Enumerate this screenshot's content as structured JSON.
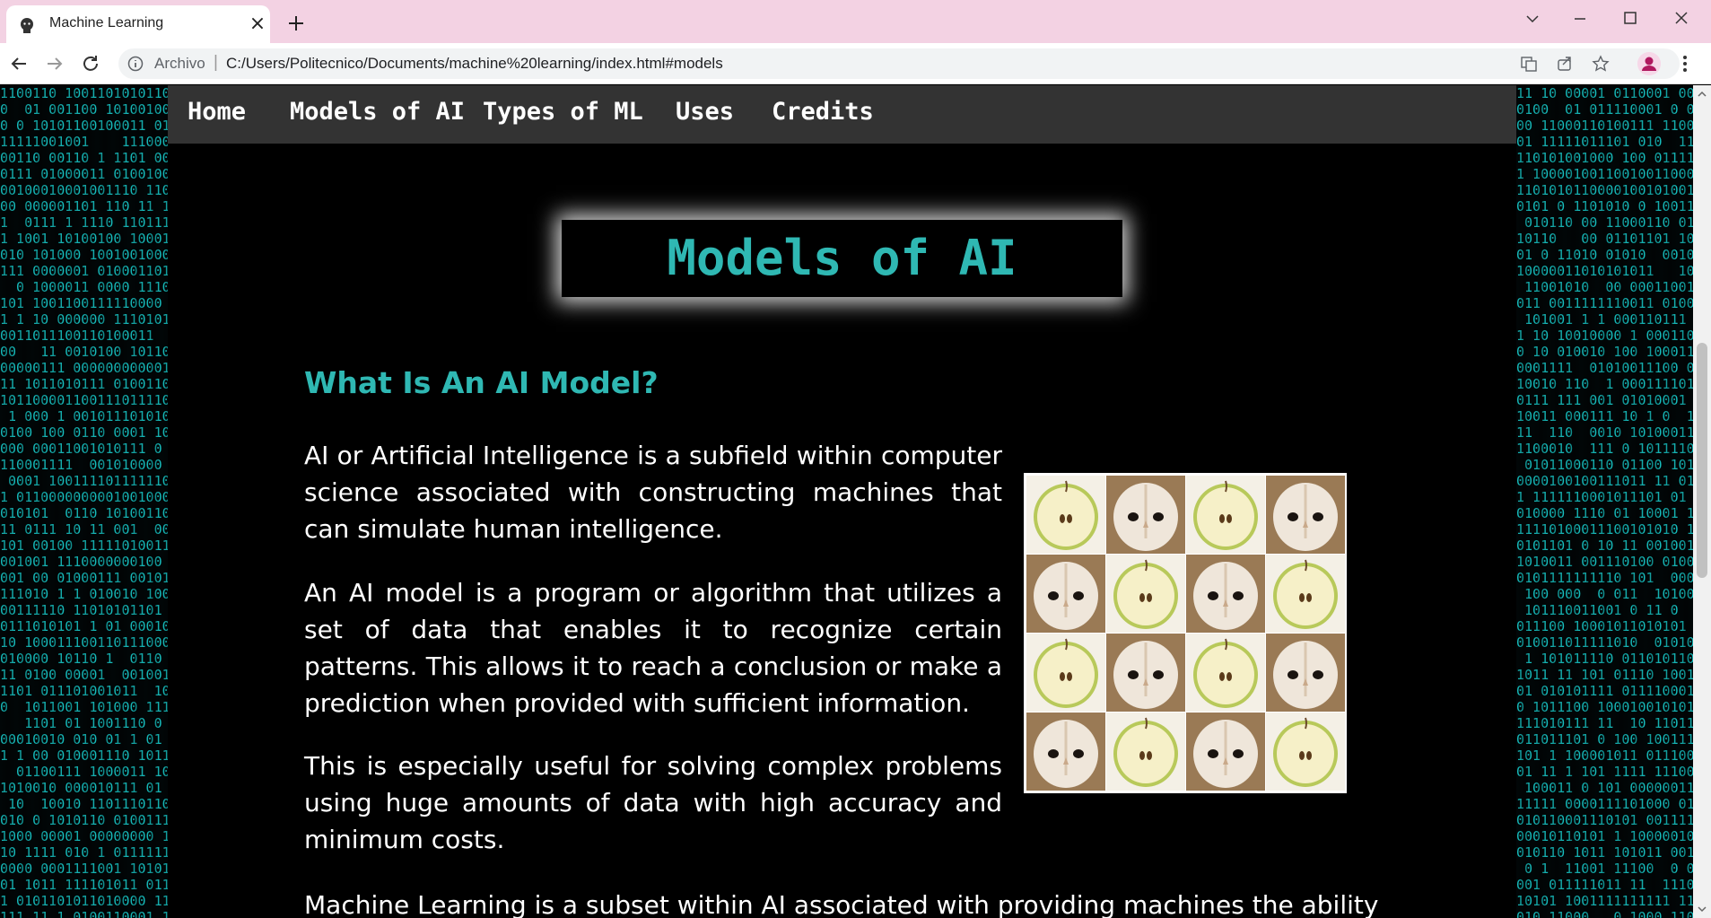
{
  "browser": {
    "tab_title": "Machine Learning",
    "tab_close": "×",
    "address_scheme": "Archivo",
    "address_separator": "|",
    "address_url": "C:/Users/Politecnico/Documents/machine%20learning/index.html#models"
  },
  "nav": {
    "items": [
      "Home",
      "Models of AI",
      "Types of ML",
      "Uses",
      "Credits"
    ]
  },
  "page": {
    "title": "Models of AI",
    "section_heading": "What Is An AI Model?",
    "paragraphs": [
      "AI or Artificial Intelligence is a subfield within computer science associated with constructing machines that can simulate human intelligence.",
      "An AI model is a program or algorithm that utilizes a set of data that enables it to recognize certain patterns. This allows it to reach a conclusion or make a prediction when provided with sufficient information.",
      "This is especially useful for solving complex problems using huge amounts of data with high accuracy and minimum costs.",
      "Machine Learning is a subset within AI associated with providing machines the ability"
    ],
    "image_tiles": [
      "apple",
      "owl",
      "apple",
      "owl",
      "owl",
      "apple",
      "owl",
      "apple",
      "apple",
      "owl",
      "apple",
      "owl",
      "owl",
      "apple",
      "owl",
      "apple"
    ]
  },
  "colors": {
    "accent": "#2fb8b3",
    "nav_bg": "#333333",
    "matrix": "#18c9c9",
    "tab_strip": "#f3d2e3"
  }
}
